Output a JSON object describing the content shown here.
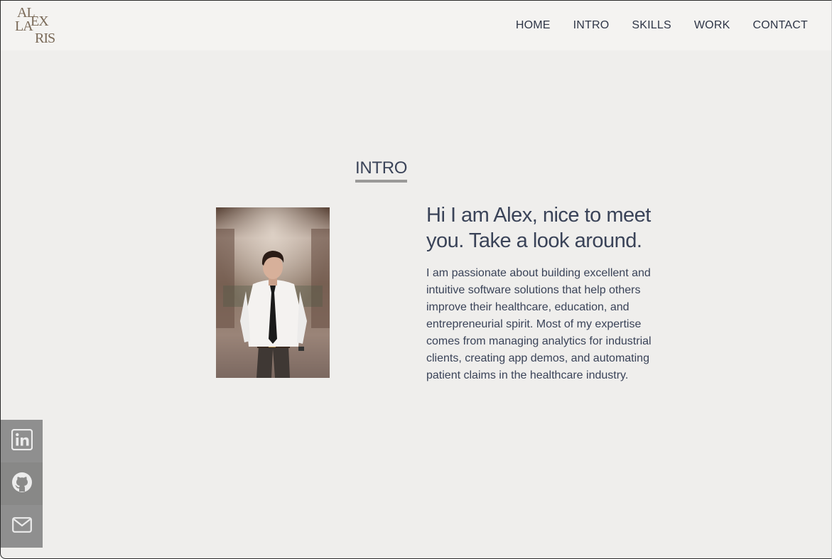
{
  "logo": {
    "line1": "AL",
    "line2": "LA",
    "line3": "EX",
    "line4": "RIS"
  },
  "nav": {
    "items": [
      {
        "label": "HOME"
      },
      {
        "label": "INTRO"
      },
      {
        "label": "SKILLS"
      },
      {
        "label": "WORK"
      },
      {
        "label": "CONTACT"
      }
    ]
  },
  "intro": {
    "title": "INTRO",
    "heading": "Hi I am Alex, nice to meet you. Take a look around.",
    "bio": "I am passionate about building excellent and intuitive software solutions that help others improve their healthcare, education, and entrepreneurial spirit. Most of my expertise comes from managing analytics for industrial clients, creating app demos, and automating patient claims in the healthcare industry."
  },
  "social": {
    "icons": [
      "linkedin-icon",
      "github-icon",
      "mail-icon"
    ]
  },
  "colors": {
    "page_background": "#efeeec",
    "nav_background": "#f4f3f1",
    "text": "#3a4358",
    "logo": "#7a6a58",
    "social_background": "#8f8f8f",
    "underline": "#9a9998"
  }
}
